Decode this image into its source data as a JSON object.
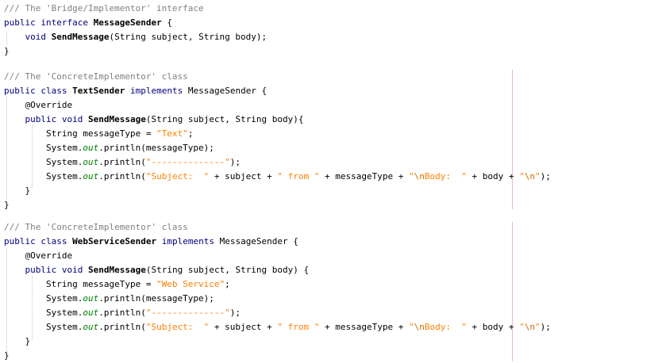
{
  "colors": {
    "keyword": "#000080",
    "comment": "#808080",
    "string": "#ff8000",
    "field": "#008000",
    "margin": "#f0b8c0"
  },
  "code": {
    "block1": {
      "comment": "/// The 'Bridge/Implementor' interface",
      "l2_public": "public",
      "l2_interface": "interface",
      "l2_name": "MessageSender",
      "l2_brace": " {",
      "l3_void": "void",
      "l3_method": "SendMessage",
      "l3_params": "(String subject, String body);",
      "close": "}"
    },
    "block2": {
      "comment": "/// The 'ConcreteImplementor' class",
      "l2_public": "public",
      "l2_class": "class",
      "l2_name": "TextSender",
      "l2_implements": "implements",
      "l2_iface": " MessageSender {",
      "override": "@Override",
      "m_public": "public",
      "m_void": "void",
      "m_name": "SendMessage",
      "m_params": "(String subject, String body){",
      "s1_pre": "String messageType = ",
      "s1_str": "\"Text\"",
      "s1_end": ";",
      "sys": "System.",
      "out": "out",
      "s2_rest": ".println(messageType);",
      "s3_open": ".println(",
      "s3_str": "\"--------------\"",
      "s3_end": ");",
      "s4_open": ".println(",
      "s4_str1": "\"Subject:  \"",
      "s4_mid1": " + subject + ",
      "s4_str2": "\" from \"",
      "s4_mid2": " + messageType + ",
      "s4_q": "\"",
      "s4_esc1": "\\n",
      "s4_str3": "Body:  \"",
      "s4_mid3": " + body + ",
      "s4_q2": "\"",
      "s4_esc2": "\\n",
      "s4_q3": "\"",
      "s4_end": ");",
      "inner_close": "}",
      "close": "}"
    },
    "block3": {
      "comment": "/// The 'ConcreteImplementor' class",
      "l2_public": "public",
      "l2_class": "class",
      "l2_name": "WebServiceSender",
      "l2_implements": "implements",
      "l2_iface": " MessageSender {",
      "override": "@Override",
      "m_public": "public",
      "m_void": "void",
      "m_name": "SendMessage",
      "m_params": "(String subject, String body) {",
      "s1_pre": "String messageType = ",
      "s1_str": "\"Web Service\"",
      "s1_end": ";",
      "sys": "System.",
      "out": "out",
      "s2_rest": ".println(messageType);",
      "s3_open": ".println(",
      "s3_str": "\"--------------\"",
      "s3_end": ");",
      "s4_open": ".println(",
      "s4_str1": "\"Subject:  \"",
      "s4_mid1": " + subject + ",
      "s4_str2": "\" from \"",
      "s4_mid2": " + messageType + ",
      "s4_q": "\"",
      "s4_esc1": "\\n",
      "s4_str3": "Body:  \"",
      "s4_mid3": " + body + ",
      "s4_q2": "\"",
      "s4_esc2": "\\n",
      "s4_q3": "\"",
      "s4_end": ");",
      "inner_close": "}",
      "close": "}"
    }
  }
}
